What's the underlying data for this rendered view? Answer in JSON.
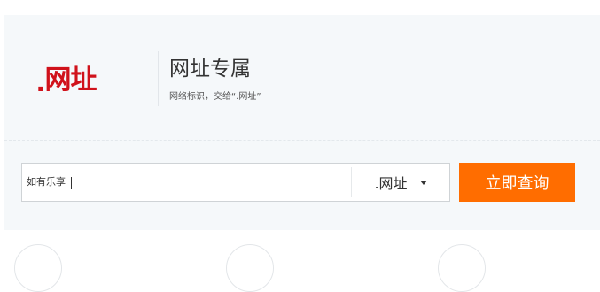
{
  "brand": {
    "logo_dot": ".",
    "logo_word": "网址",
    "logo_color": "#d0121b"
  },
  "header": {
    "title": "网址专属",
    "subtitle": "网络标识，交给“.网址”"
  },
  "search": {
    "query_value": "如有乐享",
    "suffix_selected": ".网址",
    "suffix_icon": "caret-down-icon",
    "submit_label": "立即查询",
    "accent_color": "#ff6d00"
  },
  "decorations": {
    "bottom_circles": [
      "circle-icon",
      "circle-icon",
      "circle-icon"
    ]
  }
}
